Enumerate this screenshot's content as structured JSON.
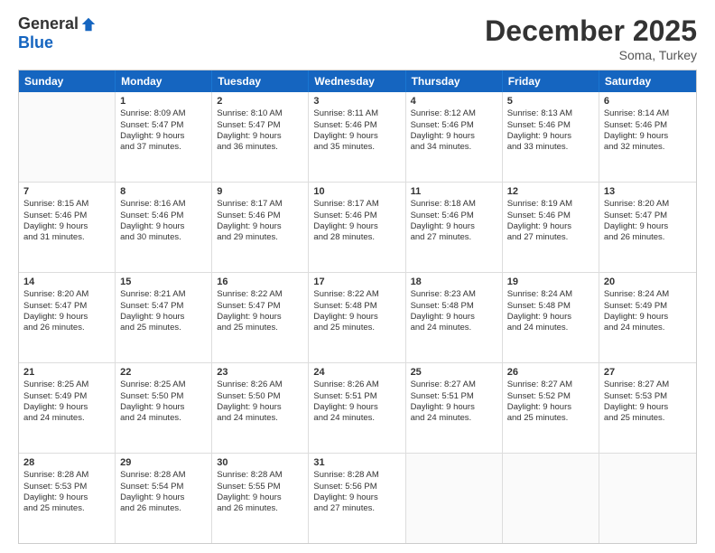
{
  "logo": {
    "general": "General",
    "blue": "Blue"
  },
  "title": "December 2025",
  "location": "Soma, Turkey",
  "header_days": [
    "Sunday",
    "Monday",
    "Tuesday",
    "Wednesday",
    "Thursday",
    "Friday",
    "Saturday"
  ],
  "weeks": [
    [
      {
        "day": "",
        "lines": []
      },
      {
        "day": "1",
        "lines": [
          "Sunrise: 8:09 AM",
          "Sunset: 5:47 PM",
          "Daylight: 9 hours",
          "and 37 minutes."
        ]
      },
      {
        "day": "2",
        "lines": [
          "Sunrise: 8:10 AM",
          "Sunset: 5:47 PM",
          "Daylight: 9 hours",
          "and 36 minutes."
        ]
      },
      {
        "day": "3",
        "lines": [
          "Sunrise: 8:11 AM",
          "Sunset: 5:46 PM",
          "Daylight: 9 hours",
          "and 35 minutes."
        ]
      },
      {
        "day": "4",
        "lines": [
          "Sunrise: 8:12 AM",
          "Sunset: 5:46 PM",
          "Daylight: 9 hours",
          "and 34 minutes."
        ]
      },
      {
        "day": "5",
        "lines": [
          "Sunrise: 8:13 AM",
          "Sunset: 5:46 PM",
          "Daylight: 9 hours",
          "and 33 minutes."
        ]
      },
      {
        "day": "6",
        "lines": [
          "Sunrise: 8:14 AM",
          "Sunset: 5:46 PM",
          "Daylight: 9 hours",
          "and 32 minutes."
        ]
      }
    ],
    [
      {
        "day": "7",
        "lines": [
          "Sunrise: 8:15 AM",
          "Sunset: 5:46 PM",
          "Daylight: 9 hours",
          "and 31 minutes."
        ]
      },
      {
        "day": "8",
        "lines": [
          "Sunrise: 8:16 AM",
          "Sunset: 5:46 PM",
          "Daylight: 9 hours",
          "and 30 minutes."
        ]
      },
      {
        "day": "9",
        "lines": [
          "Sunrise: 8:17 AM",
          "Sunset: 5:46 PM",
          "Daylight: 9 hours",
          "and 29 minutes."
        ]
      },
      {
        "day": "10",
        "lines": [
          "Sunrise: 8:17 AM",
          "Sunset: 5:46 PM",
          "Daylight: 9 hours",
          "and 28 minutes."
        ]
      },
      {
        "day": "11",
        "lines": [
          "Sunrise: 8:18 AM",
          "Sunset: 5:46 PM",
          "Daylight: 9 hours",
          "and 27 minutes."
        ]
      },
      {
        "day": "12",
        "lines": [
          "Sunrise: 8:19 AM",
          "Sunset: 5:46 PM",
          "Daylight: 9 hours",
          "and 27 minutes."
        ]
      },
      {
        "day": "13",
        "lines": [
          "Sunrise: 8:20 AM",
          "Sunset: 5:47 PM",
          "Daylight: 9 hours",
          "and 26 minutes."
        ]
      }
    ],
    [
      {
        "day": "14",
        "lines": [
          "Sunrise: 8:20 AM",
          "Sunset: 5:47 PM",
          "Daylight: 9 hours",
          "and 26 minutes."
        ]
      },
      {
        "day": "15",
        "lines": [
          "Sunrise: 8:21 AM",
          "Sunset: 5:47 PM",
          "Daylight: 9 hours",
          "and 25 minutes."
        ]
      },
      {
        "day": "16",
        "lines": [
          "Sunrise: 8:22 AM",
          "Sunset: 5:47 PM",
          "Daylight: 9 hours",
          "and 25 minutes."
        ]
      },
      {
        "day": "17",
        "lines": [
          "Sunrise: 8:22 AM",
          "Sunset: 5:48 PM",
          "Daylight: 9 hours",
          "and 25 minutes."
        ]
      },
      {
        "day": "18",
        "lines": [
          "Sunrise: 8:23 AM",
          "Sunset: 5:48 PM",
          "Daylight: 9 hours",
          "and 24 minutes."
        ]
      },
      {
        "day": "19",
        "lines": [
          "Sunrise: 8:24 AM",
          "Sunset: 5:48 PM",
          "Daylight: 9 hours",
          "and 24 minutes."
        ]
      },
      {
        "day": "20",
        "lines": [
          "Sunrise: 8:24 AM",
          "Sunset: 5:49 PM",
          "Daylight: 9 hours",
          "and 24 minutes."
        ]
      }
    ],
    [
      {
        "day": "21",
        "lines": [
          "Sunrise: 8:25 AM",
          "Sunset: 5:49 PM",
          "Daylight: 9 hours",
          "and 24 minutes."
        ]
      },
      {
        "day": "22",
        "lines": [
          "Sunrise: 8:25 AM",
          "Sunset: 5:50 PM",
          "Daylight: 9 hours",
          "and 24 minutes."
        ]
      },
      {
        "day": "23",
        "lines": [
          "Sunrise: 8:26 AM",
          "Sunset: 5:50 PM",
          "Daylight: 9 hours",
          "and 24 minutes."
        ]
      },
      {
        "day": "24",
        "lines": [
          "Sunrise: 8:26 AM",
          "Sunset: 5:51 PM",
          "Daylight: 9 hours",
          "and 24 minutes."
        ]
      },
      {
        "day": "25",
        "lines": [
          "Sunrise: 8:27 AM",
          "Sunset: 5:51 PM",
          "Daylight: 9 hours",
          "and 24 minutes."
        ]
      },
      {
        "day": "26",
        "lines": [
          "Sunrise: 8:27 AM",
          "Sunset: 5:52 PM",
          "Daylight: 9 hours",
          "and 25 minutes."
        ]
      },
      {
        "day": "27",
        "lines": [
          "Sunrise: 8:27 AM",
          "Sunset: 5:53 PM",
          "Daylight: 9 hours",
          "and 25 minutes."
        ]
      }
    ],
    [
      {
        "day": "28",
        "lines": [
          "Sunrise: 8:28 AM",
          "Sunset: 5:53 PM",
          "Daylight: 9 hours",
          "and 25 minutes."
        ]
      },
      {
        "day": "29",
        "lines": [
          "Sunrise: 8:28 AM",
          "Sunset: 5:54 PM",
          "Daylight: 9 hours",
          "and 26 minutes."
        ]
      },
      {
        "day": "30",
        "lines": [
          "Sunrise: 8:28 AM",
          "Sunset: 5:55 PM",
          "Daylight: 9 hours",
          "and 26 minutes."
        ]
      },
      {
        "day": "31",
        "lines": [
          "Sunrise: 8:28 AM",
          "Sunset: 5:56 PM",
          "Daylight: 9 hours",
          "and 27 minutes."
        ]
      },
      {
        "day": "",
        "lines": []
      },
      {
        "day": "",
        "lines": []
      },
      {
        "day": "",
        "lines": []
      }
    ]
  ]
}
